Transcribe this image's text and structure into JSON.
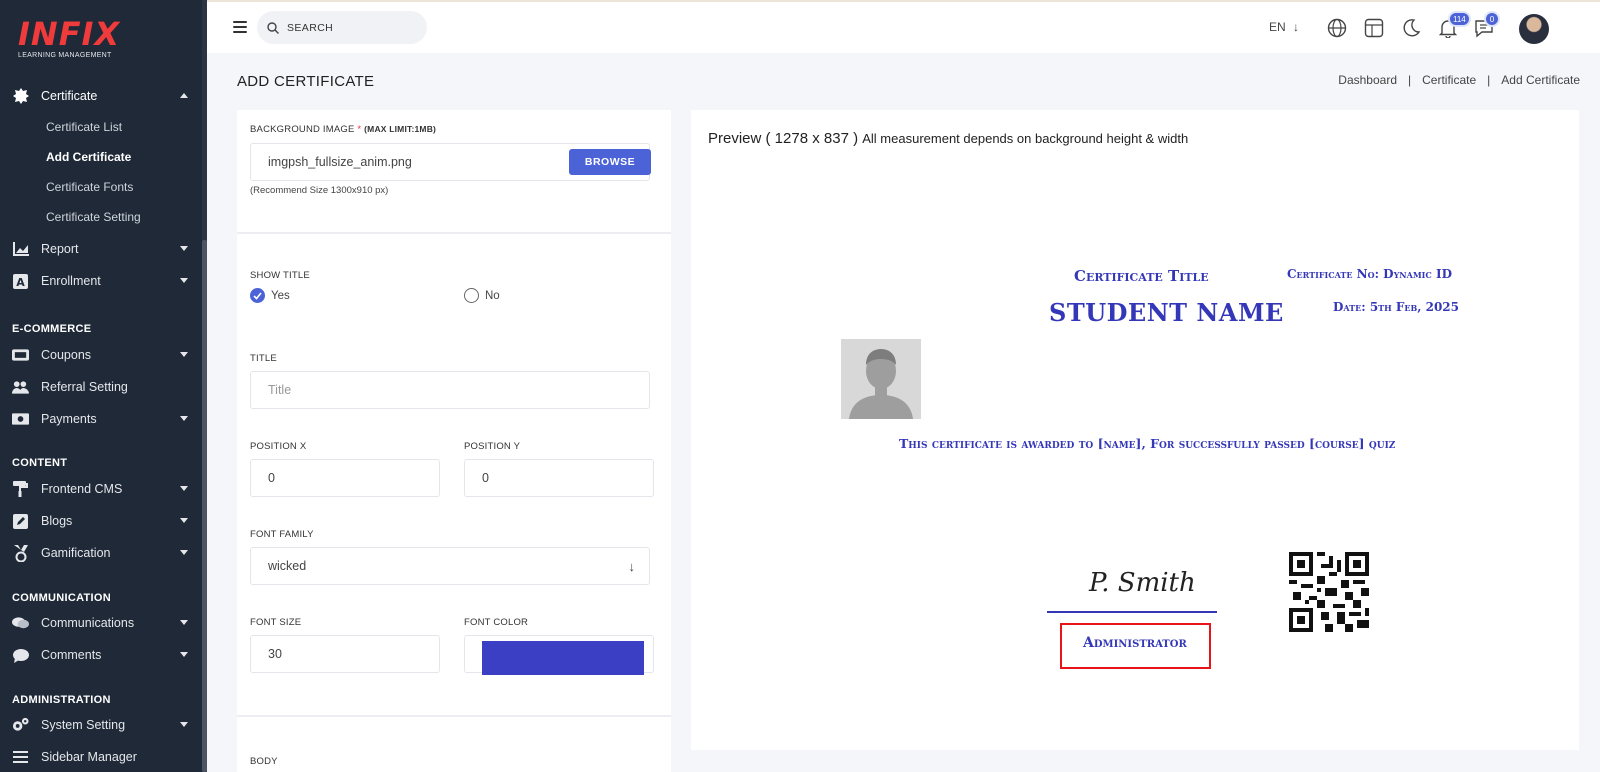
{
  "brand": {
    "logo_text": "INFIX",
    "logo_sub": "LEARNING MANAGEMENT"
  },
  "sidebar": {
    "certificate": {
      "label": "Certificate",
      "children": [
        "Certificate List",
        "Add Certificate",
        "Certificate Fonts",
        "Certificate Setting"
      ]
    },
    "report": "Report",
    "enrollment": "Enrollment",
    "sections": {
      "ecommerce": "E-COMMERCE",
      "content": "CONTENT",
      "communication": "COMMUNICATION",
      "administration": "ADMINISTRATION"
    },
    "coupons": "Coupons",
    "referral": "Referral Setting",
    "payments": "Payments",
    "frontend_cms": "Frontend CMS",
    "blogs": "Blogs",
    "gamification": "Gamification",
    "communications": "Communications",
    "comments": "Comments",
    "system_setting": "System Setting",
    "sidebar_manager": "Sidebar Manager"
  },
  "topbar": {
    "search_placeholder": "SEARCH",
    "language": "EN",
    "notifications_count": "114",
    "messages_count": "0"
  },
  "page": {
    "title": "ADD CERTIFICATE",
    "breadcrumb": [
      "Dashboard",
      "Certificate",
      "Add Certificate"
    ]
  },
  "form": {
    "background_label": "BACKGROUND IMAGE",
    "background_required": "*",
    "background_limit": "(MAX LIMIT:1MB)",
    "background_file": "imgpsh_fullsize_anim.png",
    "browse_label": "BROWSE",
    "background_hint": "(Recommend Size 1300x910 px)",
    "show_title_label": "SHOW TITLE",
    "show_title_yes": "Yes",
    "show_title_no": "No",
    "title_label": "TITLE",
    "title_placeholder": "Title",
    "position_x_label": "POSITION X",
    "position_x_value": "0",
    "position_y_label": "POSITION Y",
    "position_y_value": "0",
    "font_family_label": "FONT FAMILY",
    "font_family_value": "wicked",
    "font_size_label": "FONT SIZE",
    "font_size_value": "30",
    "font_color_label": "FONT COLOR",
    "font_color_value": "#3a3fc4",
    "body_label": "BODY"
  },
  "preview": {
    "title_main": "Preview ( 1278 x 837 )",
    "title_note": "All measurement depends on background height & width",
    "cert_title": "Certificate Title",
    "cert_no": "Certificate No: Dynamic ID",
    "student_name": "STUDENT NAME",
    "date": "Date: 5th Feb, 2025",
    "body": "This certificate is awarded to [name], For successfully passed [course] quiz",
    "signature": "P. Smith",
    "administrator": "Administrator"
  },
  "colors": {
    "accent": "#4b63d6",
    "sidebar_bg": "#1f2937",
    "cert_text": "#3437b8",
    "highlight": "#e8141a"
  }
}
